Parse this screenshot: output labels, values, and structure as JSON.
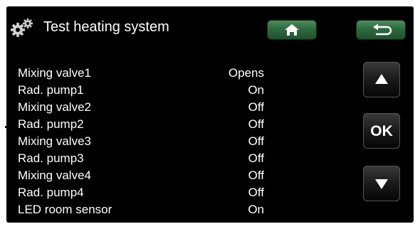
{
  "header": {
    "title": "Test heating system",
    "icons": {
      "title": "gears-icon",
      "home": "home-icon",
      "back": "return-arrow-icon"
    },
    "colors": {
      "nav_button": "#2f6a3f"
    }
  },
  "rows": [
    {
      "label": "Mixing valve1",
      "value": "Opens"
    },
    {
      "label": "Rad. pump1",
      "value": "On"
    },
    {
      "label": "Mixing valve2",
      "value": "Off"
    },
    {
      "label": "Rad. pump2",
      "value": "Off"
    },
    {
      "label": "Mixing valve3",
      "value": "Off"
    },
    {
      "label": "Rad. pump3",
      "value": "Off"
    },
    {
      "label": "Mixing valve4",
      "value": "Off"
    },
    {
      "label": "Rad. pump4",
      "value": "Off"
    },
    {
      "label": "LED room sensor",
      "value": "On"
    }
  ],
  "controls": {
    "ok_label": "OK",
    "icons": {
      "up": "triangle-up-icon",
      "down": "triangle-down-icon"
    }
  }
}
